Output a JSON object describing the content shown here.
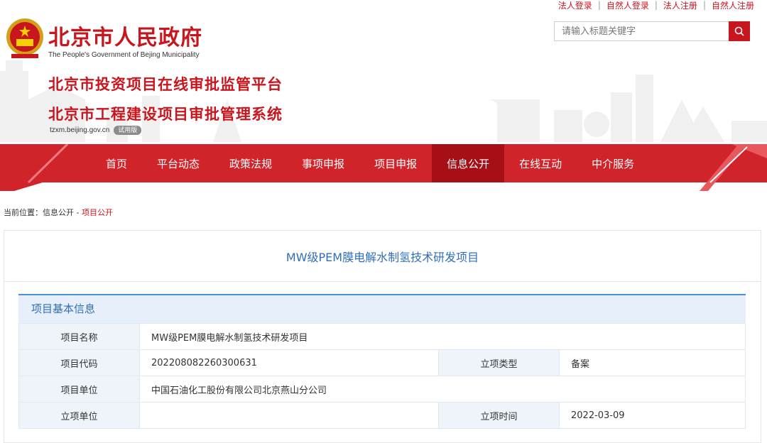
{
  "toplinks": {
    "items": [
      "法人登录",
      "自然人登录",
      "法人注册",
      "自然人注册"
    ]
  },
  "search": {
    "placeholder": "请输入标题关键字"
  },
  "brand": {
    "gov_name": "北京市人民政府",
    "gov_name_en": "The People's Government of Bejing Municipality",
    "platform_line1": "北京市投资项目在线审批监管平台",
    "platform_line2": "北京市工程建设项目审批管理系统",
    "domain": "tzxm.beijing.gov.cn",
    "trial_badge": "试用版"
  },
  "nav": {
    "items": [
      "首页",
      "平台动态",
      "政策法规",
      "事项申报",
      "项目申报",
      "信息公开",
      "在线互动",
      "中介服务"
    ],
    "active": "信息公开"
  },
  "breadcrumb": {
    "prefix": "当前位置：",
    "parent": "信息公开",
    "separator": " - ",
    "current": "项目公开"
  },
  "project": {
    "title": "MW级PEM膜电解水制氢技术研发项目",
    "section_title": "项目基本信息",
    "fields": {
      "name_label": "项目名称",
      "name_value": "MW级PEM膜电解水制氢技术研发项目",
      "code_label": "项目代码",
      "code_value": "202208082260300631",
      "type_label": "立项类型",
      "type_value": "备案",
      "unit_label": "项目单位",
      "unit_value": "中国石油化工股份有限公司北京燕山分公司",
      "approve_unit_label": "立项单位",
      "approve_unit_value": "",
      "approve_time_label": "立项时间",
      "approve_time_value": "2022-03-09"
    }
  },
  "colors": {
    "brand_red": "#c8161e",
    "nav_active": "#a70f16",
    "link_blue": "#2f6fb8",
    "table_label_bg": "#eef4fa"
  }
}
